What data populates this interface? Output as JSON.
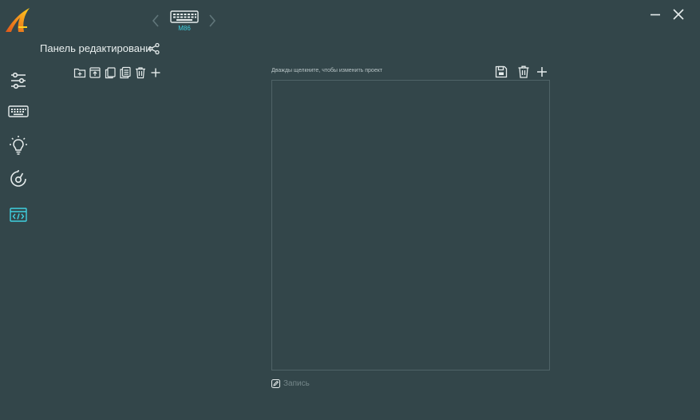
{
  "app": {
    "device": {
      "model_label": "M86"
    }
  },
  "sidebar": {
    "items": [
      {
        "icon": "sliders-icon",
        "active": false
      },
      {
        "icon": "keyboard-icon",
        "active": false
      },
      {
        "icon": "lightbulb-icon",
        "active": false
      },
      {
        "icon": "performance-dial-icon",
        "active": false
      },
      {
        "icon": "macro-code-icon",
        "active": true
      }
    ]
  },
  "panel": {
    "title": "Панель редактировани",
    "toolbar": [
      "folder-add-icon",
      "import-icon",
      "copy-icon",
      "paste-icon",
      "delete-icon",
      "add-icon"
    ]
  },
  "editor": {
    "hint": "Дважды щелкните, чтобы изменить проект",
    "toolbar": [
      "save-icon",
      "delete-icon",
      "add-icon"
    ],
    "record_label": "Запись"
  },
  "colors": {
    "background": "#33464a",
    "accent": "#3fd0e0",
    "icon": "#e6ecec",
    "logo_orange": "#f08a1c",
    "logo_yellow": "#ffd21f"
  }
}
